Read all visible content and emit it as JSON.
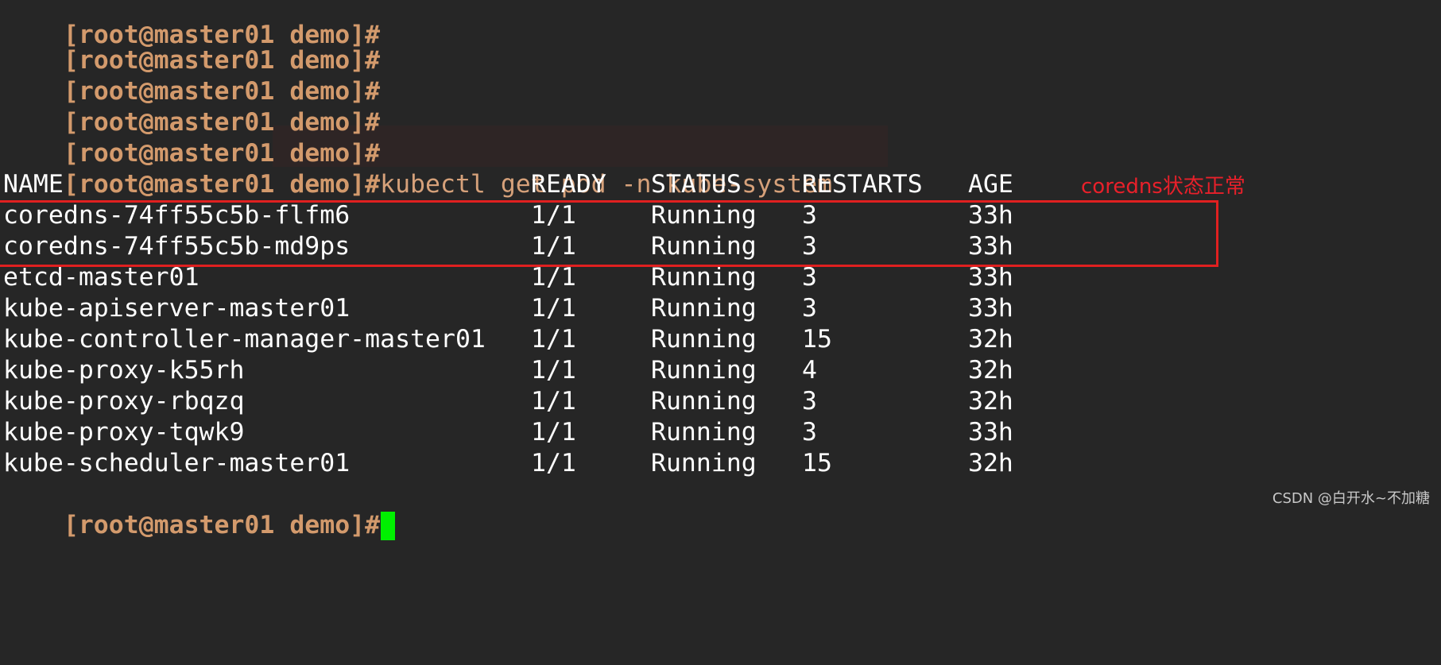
{
  "prompt": "[root@master01 demo]#",
  "command": "kubectl get pod -n kube-system",
  "headers": {
    "name": "NAME",
    "ready": "READY",
    "status": "STATUS",
    "restarts": "RESTARTS",
    "age": "AGE"
  },
  "pods": [
    {
      "name": "coredns-74ff55c5b-flfm6",
      "ready": "1/1",
      "status": "Running",
      "restarts": "3",
      "age": "33h"
    },
    {
      "name": "coredns-74ff55c5b-md9ps",
      "ready": "1/1",
      "status": "Running",
      "restarts": "3",
      "age": "33h"
    },
    {
      "name": "etcd-master01",
      "ready": "1/1",
      "status": "Running",
      "restarts": "3",
      "age": "33h"
    },
    {
      "name": "kube-apiserver-master01",
      "ready": "1/1",
      "status": "Running",
      "restarts": "3",
      "age": "33h"
    },
    {
      "name": "kube-controller-manager-master01",
      "ready": "1/1",
      "status": "Running",
      "restarts": "15",
      "age": "32h"
    },
    {
      "name": "kube-proxy-k55rh",
      "ready": "1/1",
      "status": "Running",
      "restarts": "4",
      "age": "32h"
    },
    {
      "name": "kube-proxy-rbqzq",
      "ready": "1/1",
      "status": "Running",
      "restarts": "3",
      "age": "32h"
    },
    {
      "name": "kube-proxy-tqwk9",
      "ready": "1/1",
      "status": "Running",
      "restarts": "3",
      "age": "33h"
    },
    {
      "name": "kube-scheduler-master01",
      "ready": "1/1",
      "status": "Running",
      "restarts": "15",
      "age": "32h"
    }
  ],
  "annotation": "coredns状态正常",
  "watermark": "CSDN @白开水~不加糖",
  "colors": {
    "background": "#262626",
    "prompt": "#d39a6c",
    "text": "#ffffff",
    "annotation": "#e02020",
    "cursor": "#00f000"
  }
}
